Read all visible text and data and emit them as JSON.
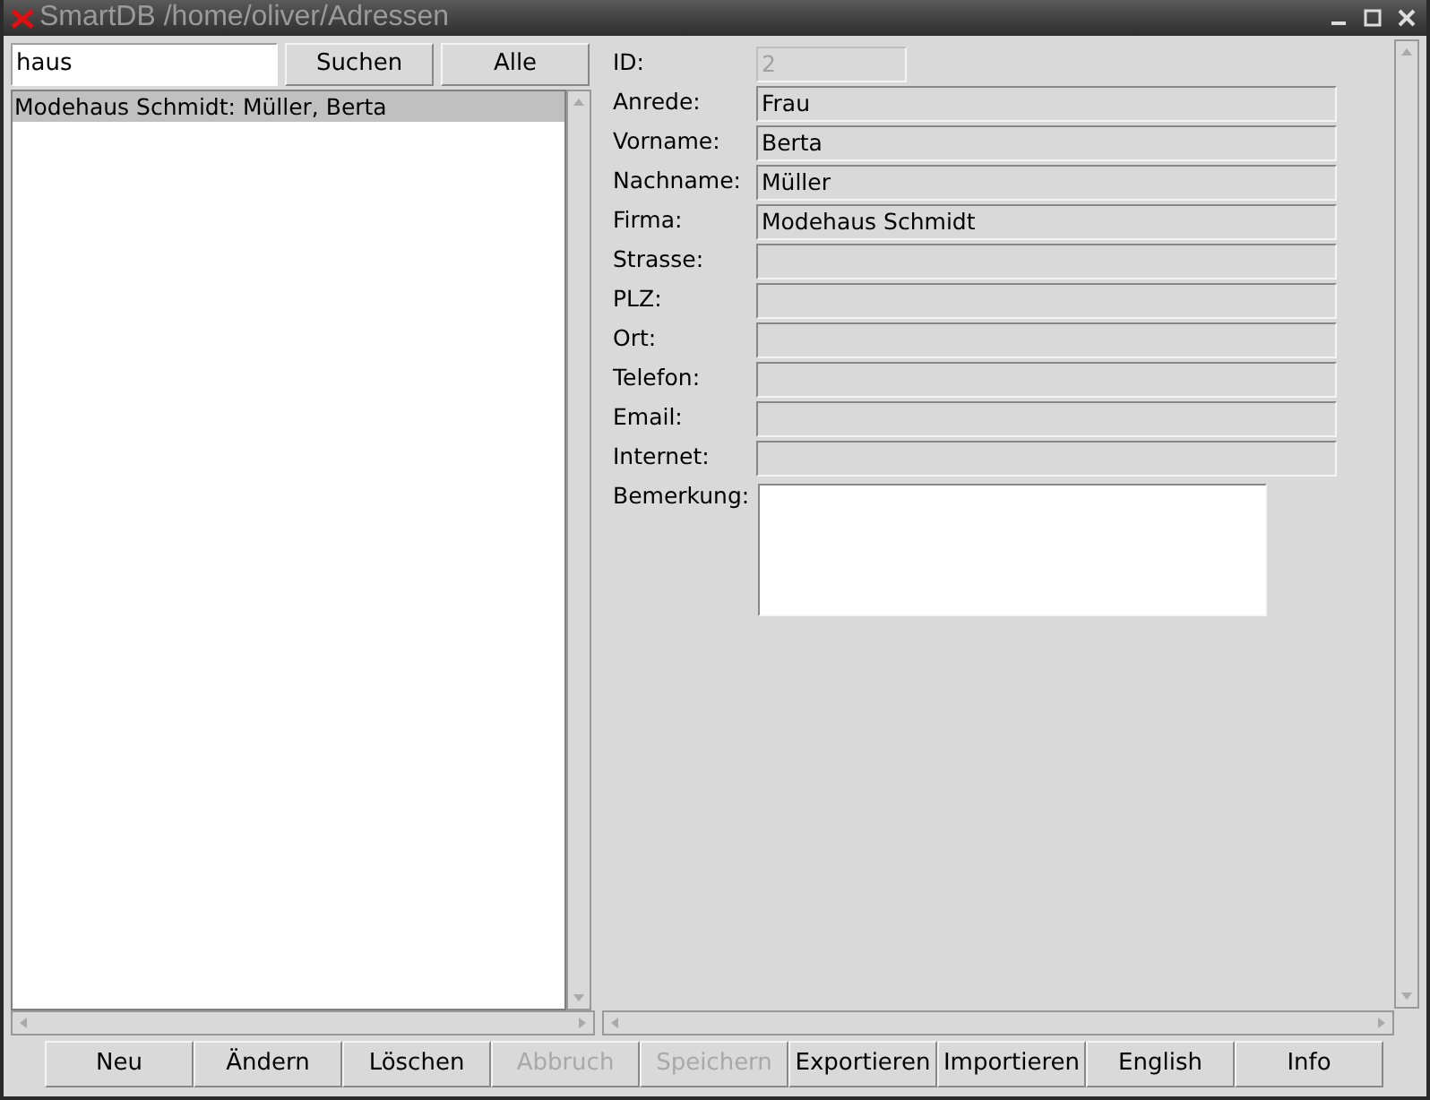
{
  "window": {
    "title": "SmartDB /home/oliver/Adressen"
  },
  "search": {
    "value": "haus",
    "buttons": [
      "Suchen",
      "Alle"
    ]
  },
  "results": [
    {
      "label": "Modehaus Schmidt: Müller, Berta",
      "selected": true
    }
  ],
  "fields": [
    {
      "label": "ID:",
      "value": "2",
      "kind": "short",
      "disabled": true
    },
    {
      "label": "Anrede:",
      "value": "Frau",
      "kind": "line",
      "disabled": false
    },
    {
      "label": "Vorname:",
      "value": "Berta",
      "kind": "line",
      "disabled": false
    },
    {
      "label": "Nachname:",
      "value": "Müller",
      "kind": "line",
      "disabled": false
    },
    {
      "label": "Firma:",
      "value": "Modehaus Schmidt",
      "kind": "line",
      "disabled": false
    },
    {
      "label": "Strasse:",
      "kind": "line",
      "disabled": false
    },
    {
      "label": "PLZ:",
      "kind": "line",
      "disabled": false
    },
    {
      "label": "Ort:",
      "kind": "line",
      "disabled": false
    },
    {
      "label": "Telefon:",
      "kind": "line",
      "disabled": false
    },
    {
      "label": "Email:",
      "kind": "line",
      "disabled": false
    },
    {
      "label": "Internet:",
      "kind": "line",
      "disabled": false
    },
    {
      "label": "Bemerkung:",
      "kind": "memo",
      "disabled": false
    }
  ],
  "buttons": [
    {
      "label": "Neu",
      "disabled": false
    },
    {
      "label": "Ändern",
      "disabled": false
    },
    {
      "label": "Löschen",
      "disabled": false
    },
    {
      "label": "Abbruch",
      "disabled": true
    },
    {
      "label": "Speichern",
      "disabled": true
    },
    {
      "label": "Exportieren",
      "disabled": false
    },
    {
      "label": "Importieren",
      "disabled": false
    },
    {
      "label": "English",
      "disabled": false
    },
    {
      "label": "Info",
      "disabled": false
    }
  ]
}
